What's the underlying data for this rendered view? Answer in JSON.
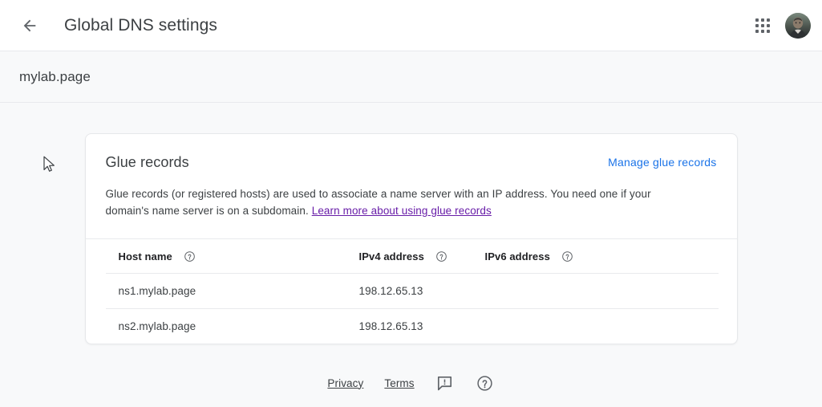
{
  "appbar": {
    "back_icon": "arrow-left-icon",
    "title": "Global DNS settings",
    "apps_icon": "apps-grid-icon",
    "avatar_icon": "user-avatar"
  },
  "subheader": {
    "domain": "mylab.page"
  },
  "card": {
    "title": "Glue records",
    "manage_link": "Manage glue records",
    "description_part1": "Glue records (or registered hosts) are used to associate a name server with an IP address. You need one if your domain's name server is on a subdomain. ",
    "learn_more_link": "Learn more about using glue records",
    "table": {
      "columns": [
        {
          "label": "Host name",
          "help_icon": "help-circle-icon"
        },
        {
          "label": "IPv4 address",
          "help_icon": "help-circle-icon"
        },
        {
          "label": "IPv6 address",
          "help_icon": "help-circle-icon"
        }
      ],
      "rows": [
        {
          "host_name": "ns1.mylab.page",
          "ipv4": "198.12.65.13",
          "ipv6": ""
        },
        {
          "host_name": "ns2.mylab.page",
          "ipv4": "198.12.65.13",
          "ipv6": ""
        }
      ]
    }
  },
  "footer": {
    "privacy": "Privacy",
    "terms": "Terms",
    "feedback_icon": "feedback-icon",
    "help_icon": "help-circle-icon"
  },
  "colors": {
    "link_blue": "#1a73e8",
    "link_visited_purple": "#681da8",
    "page_background": "#f8f9fa",
    "card_background": "#ffffff",
    "text_primary": "#3c4043",
    "divider": "#e8eaed"
  }
}
